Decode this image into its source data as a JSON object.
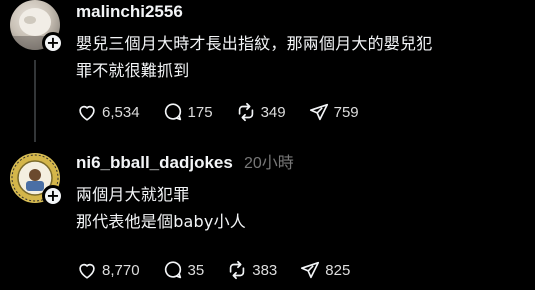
{
  "posts": [
    {
      "username": "malinchi2556",
      "text_lines": [
        "嬰兒三個月大時才長出指紋，那兩個月大的嬰兒犯",
        "罪不就很難抓到"
      ],
      "likes": "6,534",
      "replies": "175",
      "reposts": "349",
      "shares": "759"
    },
    {
      "username": "ni6_bball_dadjokes",
      "timestamp": "20小時",
      "text_lines": [
        "兩個月大就犯罪",
        "那代表他是個baby小人"
      ],
      "likes": "8,770",
      "replies": "35",
      "reposts": "383",
      "shares": "825"
    }
  ],
  "icons": {
    "follow": "plus-icon",
    "like": "heart-icon",
    "reply": "comment-icon",
    "repost": "repost-icon",
    "share": "send-icon"
  },
  "colors": {
    "background": "#000000",
    "primary_text": "#f3f5f7",
    "secondary_text": "#777777",
    "thread_line": "#333638"
  }
}
